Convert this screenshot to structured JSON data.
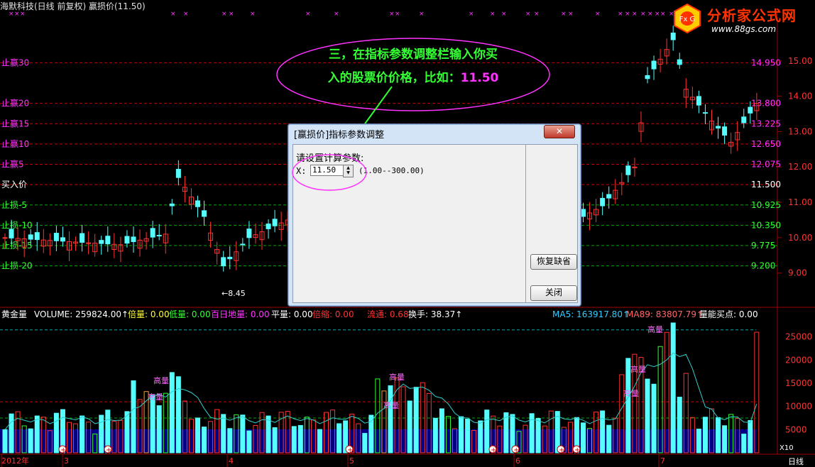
{
  "window": {
    "title": "海默科技(日线 前复权) 赢损价(11.50)"
  },
  "logo": {
    "name": "分析家公式网",
    "url": "www.88gs.com",
    "badge": "Fx G"
  },
  "callout": {
    "line1": "三，在指标参数调整栏输入你买",
    "line2": "入的股票价价格，比如：",
    "value": "11.50"
  },
  "dialog": {
    "title": "[赢损价]指标参数调整",
    "close_label": "关闭",
    "prompt": "请设置计算参数:",
    "param_name": "X:",
    "param_value": "11.50",
    "range": "(1.00--300.00)",
    "restore_label": "恢复缺省",
    "close_button_label": "关闭"
  },
  "levels": [
    {
      "label": "止赢30",
      "value": "14.950",
      "color": "#ff33ff"
    },
    {
      "label": "止赢20",
      "value": "13.800",
      "color": "#ff33ff"
    },
    {
      "label": "止赢15",
      "value": "13.225",
      "color": "#ff33ff"
    },
    {
      "label": "止赢10",
      "value": "12.650",
      "color": "#ff33ff"
    },
    {
      "label": "止赢5",
      "value": "12.075",
      "color": "#ff33ff"
    },
    {
      "label": "买入价",
      "value": "11.500",
      "color": "#ffffff"
    },
    {
      "label": "止损-5",
      "value": "10.925",
      "color": "#33ff33"
    },
    {
      "label": "止损-10",
      "value": "10.350",
      "color": "#33ff33"
    },
    {
      "label": "止损-15",
      "value": "9.775",
      "color": "#33ff33"
    },
    {
      "label": "止损-20",
      "value": "9.200",
      "color": "#33ff33"
    }
  ],
  "price_axis": [
    "15.00",
    "14.00",
    "13.00",
    "12.00",
    "11.00",
    "10.00",
    "9.00"
  ],
  "low_marker": "8.45",
  "volume_header": [
    {
      "text": "黄金量",
      "color": "#ffffff"
    },
    {
      "text": "VOLUME: 259824.00↑",
      "color": "#ffffff"
    },
    {
      "text": "倍量: 0.00",
      "color": "#ffff33"
    },
    {
      "text": "低量: 0.00",
      "color": "#33ff33"
    },
    {
      "text": "百日地量: 0.00",
      "color": "#ff33ff"
    },
    {
      "text": "平量: 0.00",
      "color": "#ffffff"
    },
    {
      "text": "倍缩: 0.00",
      "color": "#ff3333"
    },
    {
      "text": "流通: 0.68",
      "color": "#ff3333"
    },
    {
      "text": "换手: 38.37↑",
      "color": "#ffffff"
    },
    {
      "text": "MA5: 163917.80↑",
      "color": "#33ccff"
    },
    {
      "text": "MA89: 83807.79↑",
      "color": "#ff6666"
    },
    {
      "text": "量能买点: 0.00",
      "color": "#ffffff"
    }
  ],
  "volume_axis": [
    "25000",
    "20000",
    "15000",
    "10000",
    "5000"
  ],
  "volume_unit": "X10",
  "high_volume_label": "高量",
  "date_axis": [
    "2012年",
    "3",
    "4",
    "5",
    "6",
    "7"
  ],
  "period_label": "日线",
  "colors": {
    "up": "#ff3333",
    "down": "#55ffff",
    "ma": "#33cccc",
    "grid": "#990000"
  },
  "chart_data": {
    "type": "candlestick",
    "price_min": 8.45,
    "price_max": 15.6,
    "volume_max": 28000
  }
}
